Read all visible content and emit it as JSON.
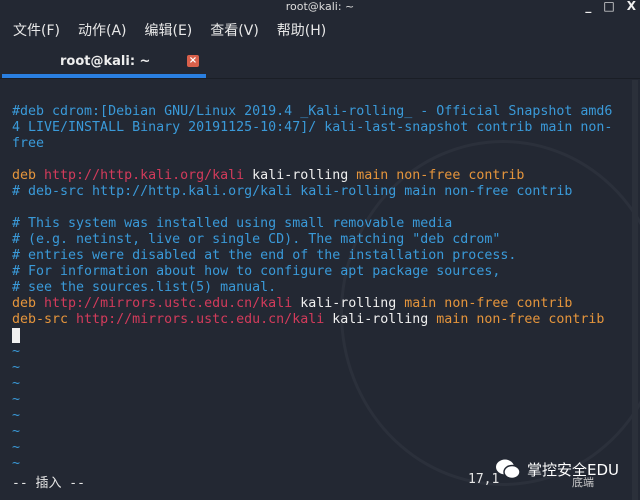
{
  "window": {
    "title": "root@kali: ~",
    "controls": [
      "minimize",
      "maximize",
      "close"
    ]
  },
  "menu": [
    {
      "label": "文件(F)"
    },
    {
      "label": "动作(A)"
    },
    {
      "label": "编辑(E)"
    },
    {
      "label": "查看(V)"
    },
    {
      "label": "帮助(H)"
    }
  ],
  "tab": {
    "label": "root@kali: ~",
    "close": "×"
  },
  "colors": {
    "comment": "#3a9ad9",
    "keyword": "#e5953c",
    "url": "#d23b5b",
    "text": "#f0f0f0",
    "background": "#232833",
    "tab_indicator": "#2a7fe0"
  },
  "lines": [
    [
      {
        "t": "#deb cdrom:[Debian GNU/Linux 2019.4 _Kali-rolling_ - Official Snapshot amd6",
        "c": "c"
      }
    ],
    [
      {
        "t": "4 LIVE/INSTALL Binary 20191125-10:47]/ kali-last-snapshot contrib main non-",
        "c": "c"
      }
    ],
    [
      {
        "t": "free",
        "c": "c"
      }
    ],
    [],
    [
      {
        "t": "deb ",
        "c": "k"
      },
      {
        "t": "http://http.kali.org/kali",
        "c": "u"
      },
      {
        "t": " kali-rolling ",
        "c": "w"
      },
      {
        "t": "main non-free contrib",
        "c": "k"
      }
    ],
    [
      {
        "t": "# deb-src http://http.kali.org/kali kali-rolling main non-free contrib",
        "c": "c"
      }
    ],
    [],
    [
      {
        "t": "# This system was installed using small removable media",
        "c": "c"
      }
    ],
    [
      {
        "t": "# (e.g. netinst, live or single CD). The matching \"deb cdrom\"",
        "c": "c"
      }
    ],
    [
      {
        "t": "# entries were disabled at the end of the installation process.",
        "c": "c"
      }
    ],
    [
      {
        "t": "# For information about how to configure apt package sources,",
        "c": "c"
      }
    ],
    [
      {
        "t": "# see the sources.list(5) manual.",
        "c": "c"
      }
    ],
    [
      {
        "t": "deb ",
        "c": "k"
      },
      {
        "t": "http://mirrors.ustc.edu.cn/kali",
        "c": "u"
      },
      {
        "t": " kali-rolling ",
        "c": "w"
      },
      {
        "t": "main non-free contrib",
        "c": "k"
      }
    ],
    [
      {
        "t": "deb-src ",
        "c": "k"
      },
      {
        "t": "http://mirrors.ustc.edu.cn/kali",
        "c": "u"
      },
      {
        "t": " kali-rolling ",
        "c": "w"
      },
      {
        "t": "main non-free contrib",
        "c": "k"
      }
    ]
  ],
  "tildes": [
    "~",
    "~",
    "~",
    "~",
    "~",
    "~",
    "~",
    "~"
  ],
  "status": {
    "mode": "-- 插入 --",
    "position": "17,1",
    "scroll": "底端"
  },
  "watermark": {
    "text": "掌控安全EDU",
    "icon": "wechat-icon"
  }
}
